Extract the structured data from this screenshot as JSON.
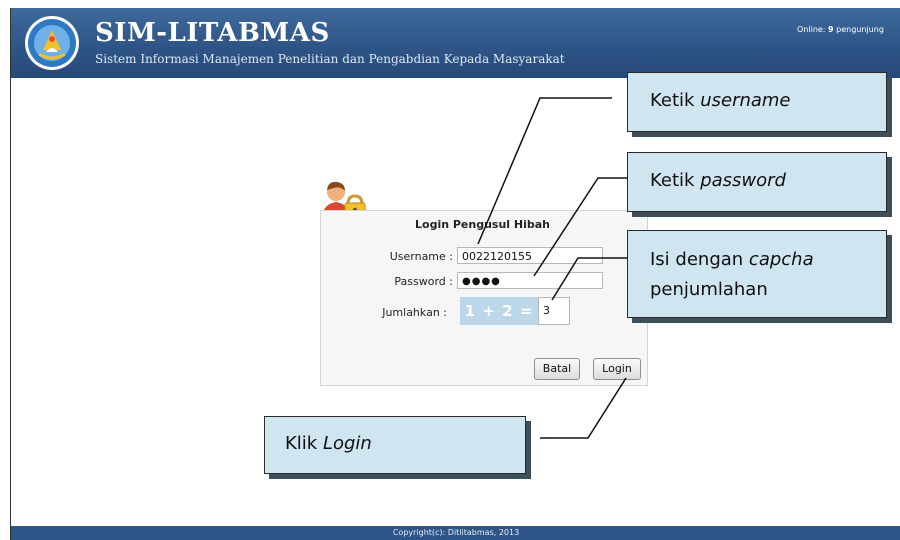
{
  "header": {
    "title": "SIM-LITABMAS",
    "subtitle": "Sistem Informasi Manajemen Penelitian dan Pengabdian Kepada Masyarakat",
    "online_label": "Online:",
    "online_count": "9",
    "online_suffix": "pengunjung"
  },
  "login": {
    "title": "Login Pengusul Hibah",
    "username_label": "Username :",
    "username_value": "0022120155",
    "password_label": "Password :",
    "password_value": "●●●●",
    "captcha_label": "Jumlahkan :",
    "captcha_text": "1 + 2 =",
    "captcha_value": "3",
    "cancel_label": "Batal",
    "login_label": "Login"
  },
  "annotations": {
    "username_prefix": "Ketik",
    "username_em": "username",
    "password_prefix": "Ketik",
    "password_em": "password",
    "captcha_prefix": "Isi dengan",
    "captcha_em": "capcha",
    "captcha_line2": "penjumlahan",
    "login_prefix": "Klik",
    "login_em": "Login"
  },
  "footer": {
    "copyright": "Copyright(c): Ditlitabmas, 2013"
  },
  "colors": {
    "header": "#2e5587",
    "callout_fill": "#cfe5ef",
    "captcha_bg": "#bcd6ea"
  },
  "icons": [
    "tut-wuri-logo-icon",
    "user-lock-icon"
  ]
}
